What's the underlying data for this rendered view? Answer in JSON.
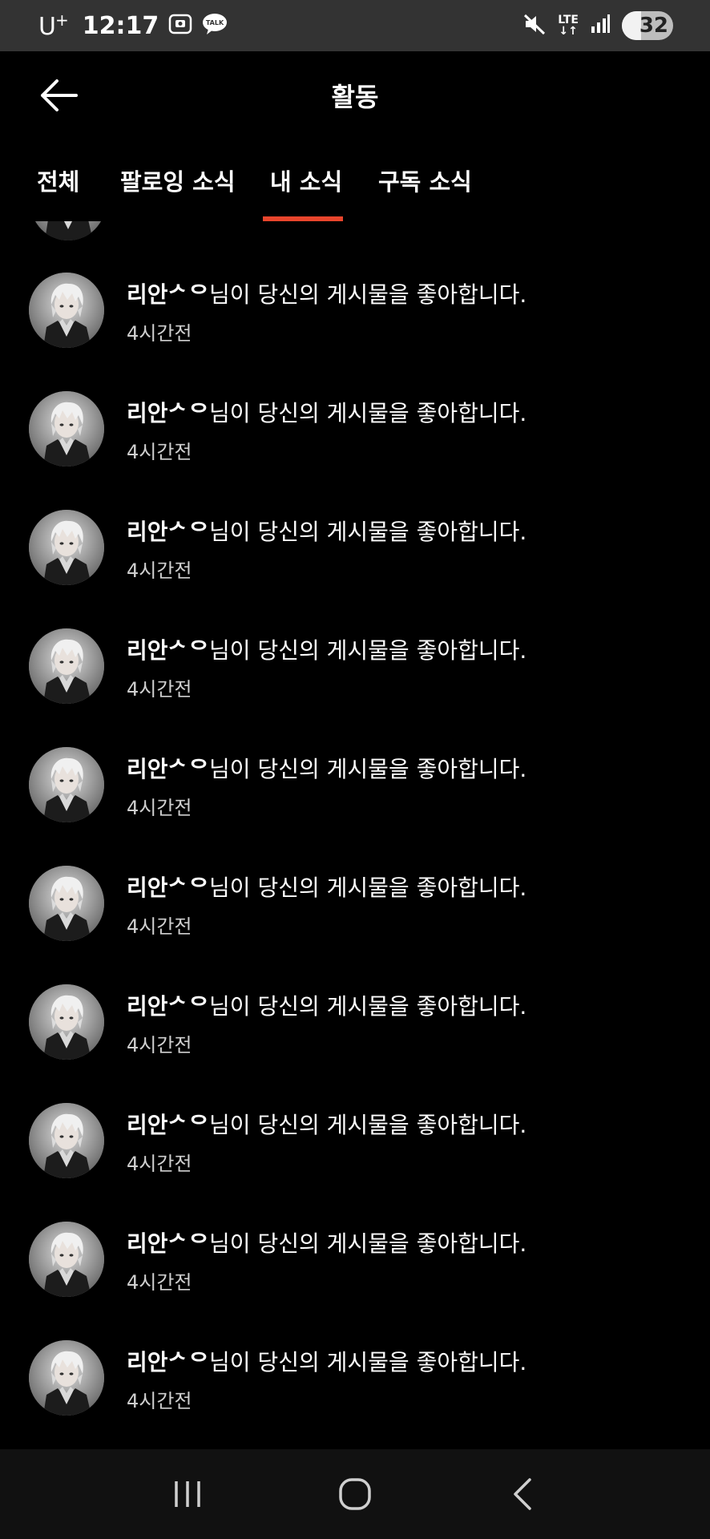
{
  "status_bar": {
    "carrier": "U",
    "carrier_sup": "+",
    "time": "12:17",
    "network": "LTE",
    "battery": "32"
  },
  "header": {
    "title": "활동"
  },
  "tabs": [
    {
      "label": "전체",
      "active": false
    },
    {
      "label": "팔로잉 소식",
      "active": false
    },
    {
      "label": "내 소식",
      "active": true
    },
    {
      "label": "구독 소식",
      "active": false
    }
  ],
  "accent_color": "#e8452c",
  "notifications": [
    {
      "name": "리안ᄼᄋ",
      "message": "님이 당신의 게시물을 좋아합니다.",
      "time": "4시간전"
    },
    {
      "name": "리안ᄼᄋ",
      "message": "님이 당신의 게시물을 좋아합니다.",
      "time": "4시간전"
    },
    {
      "name": "리안ᄼᄋ",
      "message": "님이 당신의 게시물을 좋아합니다.",
      "time": "4시간전"
    },
    {
      "name": "리안ᄼᄋ",
      "message": "님이 당신의 게시물을 좋아합니다.",
      "time": "4시간전"
    },
    {
      "name": "리안ᄼᄋ",
      "message": "님이 당신의 게시물을 좋아합니다.",
      "time": "4시간전"
    },
    {
      "name": "리안ᄼᄋ",
      "message": "님이 당신의 게시물을 좋아합니다.",
      "time": "4시간전"
    },
    {
      "name": "리안ᄼᄋ",
      "message": "님이 당신의 게시물을 좋아합니다.",
      "time": "4시간전"
    },
    {
      "name": "리안ᄼᄋ",
      "message": "님이 당신의 게시물을 좋아합니다.",
      "time": "4시간전"
    },
    {
      "name": "리안ᄼᄋ",
      "message": "님이 당신의 게시물을 좋아합니다.",
      "time": "4시간전"
    },
    {
      "name": "리안ᄼᄋ",
      "message": "님이 당신의 게시물을 좋아합니다.",
      "time": "4시간전"
    }
  ]
}
